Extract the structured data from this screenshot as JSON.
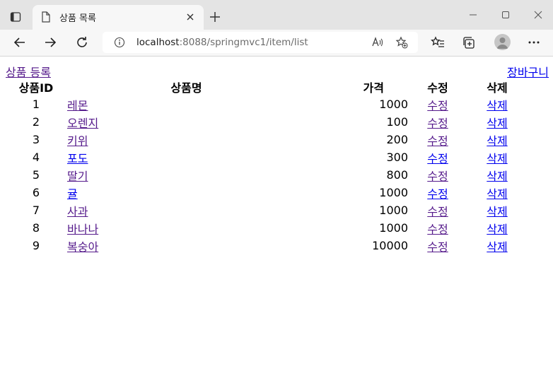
{
  "browser": {
    "tab": {
      "title": "상품 목록"
    },
    "address": {
      "host": "localhost",
      "rest": ":8088/springmvc1/item/list"
    }
  },
  "page": {
    "register_link": "상품 등록",
    "cart_link": "장바구니",
    "table": {
      "headers": {
        "id": "상품ID",
        "name": "상품명",
        "price": "가격",
        "edit": "수정",
        "delete": "삭제"
      },
      "rows": [
        {
          "id": "1",
          "name": "레몬",
          "price": "1000",
          "edit": "수정",
          "delete": "삭제",
          "name_visited": true,
          "edit_visited": true
        },
        {
          "id": "2",
          "name": "오렌지",
          "price": "100",
          "edit": "수정",
          "delete": "삭제",
          "name_visited": true,
          "edit_visited": true
        },
        {
          "id": "3",
          "name": "키위",
          "price": "200",
          "edit": "수정",
          "delete": "삭제",
          "name_visited": true,
          "edit_visited": true
        },
        {
          "id": "4",
          "name": "포도",
          "price": "300",
          "edit": "수정",
          "delete": "삭제",
          "name_visited": false,
          "edit_visited": false
        },
        {
          "id": "5",
          "name": "딸기",
          "price": "800",
          "edit": "수정",
          "delete": "삭제",
          "name_visited": true,
          "edit_visited": true
        },
        {
          "id": "6",
          "name": "귤",
          "price": "1000",
          "edit": "수정",
          "delete": "삭제",
          "name_visited": false,
          "edit_visited": false
        },
        {
          "id": "7",
          "name": "사과",
          "price": "1000",
          "edit": "수정",
          "delete": "삭제",
          "name_visited": true,
          "edit_visited": true
        },
        {
          "id": "8",
          "name": "바나나",
          "price": "1000",
          "edit": "수정",
          "delete": "삭제",
          "name_visited": true,
          "edit_visited": true
        },
        {
          "id": "9",
          "name": "복숭아",
          "price": "10000",
          "edit": "수정",
          "delete": "삭제",
          "name_visited": true,
          "edit_visited": true
        }
      ]
    }
  },
  "colors": {
    "visited_link": "#551a8b",
    "unvisited_link": "#0000ee"
  }
}
